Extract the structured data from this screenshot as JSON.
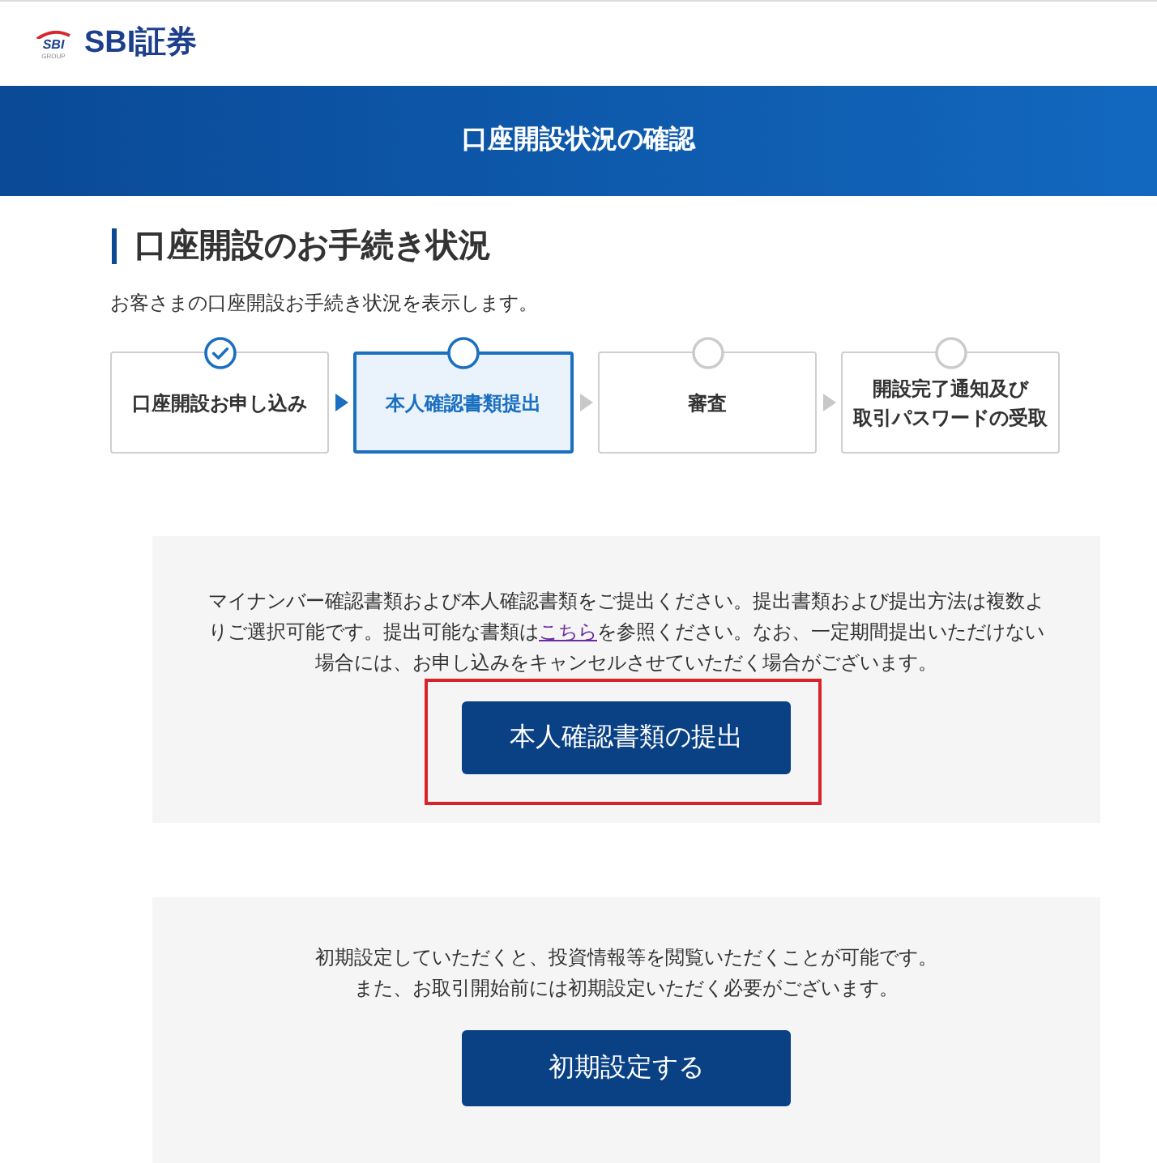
{
  "header": {
    "logo": {
      "emblem_text": "SBI",
      "emblem_subtext": "GROUP",
      "name": "SBI証券"
    }
  },
  "banner": {
    "title": "口座開設状況の確認"
  },
  "section": {
    "heading": "口座開設のお手続き状況",
    "description": "お客さまの口座開設お手続き状況を表示します。"
  },
  "steps": [
    {
      "label_lines": [
        "口座開設お申し込み"
      ],
      "completed": true,
      "current": false
    },
    {
      "label_lines": [
        "本人確認書類提出"
      ],
      "completed": false,
      "current": true
    },
    {
      "label_lines": [
        "審査"
      ],
      "completed": false,
      "current": false
    },
    {
      "label_lines": [
        "開設完了通知及び",
        "取引パスワードの受取"
      ],
      "completed": false,
      "current": false
    }
  ],
  "panels": [
    {
      "lines": [
        [
          {
            "kind": "text",
            "text": "マイナンバー確認書類および本人確認書類をご提出ください。提出書類および提出方法は複数よりご選択可能です。提出可能な書類は"
          },
          {
            "kind": "link",
            "text": "こちら"
          },
          {
            "kind": "text",
            "text": "を参照ください。なお、一定期間提出いただけない場合には、お申し込みをキャンセルさせていただく場合がございます。"
          }
        ]
      ],
      "button": {
        "label": "本人確認書類の提出",
        "highlighted": true
      }
    },
    {
      "lines": [
        [
          {
            "kind": "text",
            "text": "初期設定していただくと、投資情報等を閲覧いただくことが可能です。"
          }
        ],
        [
          {
            "kind": "text",
            "text": "また、お取引開始前には初期設定いただく必要がございます。"
          }
        ]
      ],
      "button": {
        "label": "初期設定する",
        "highlighted": false
      }
    }
  ]
}
